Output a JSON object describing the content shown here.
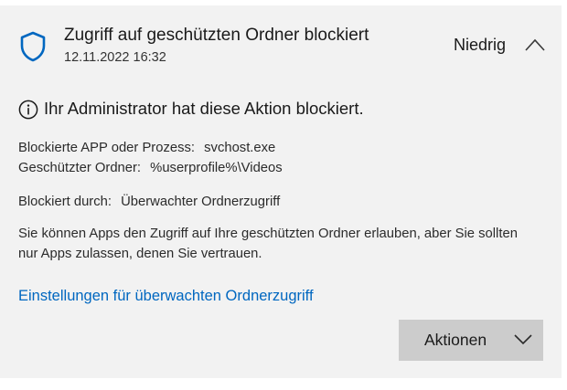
{
  "header": {
    "title": "Zugriff auf geschützten Ordner blockiert",
    "timestamp": "12.11.2022 16:32",
    "severity": "Niedrig",
    "icon": "shield-icon",
    "expand_icon": "chevron-up-icon"
  },
  "notice": {
    "icon": "info-icon",
    "text": "Ihr Administrator hat diese Aktion blockiert."
  },
  "details": {
    "app_label": "Blockierte APP oder Prozess:",
    "app_value": "svchost.exe",
    "folder_label": "Geschützter Ordner:",
    "folder_value": "%userprofile%\\Videos",
    "blocked_by_label": "Blockiert durch:",
    "blocked_by_value": "Überwachter Ordnerzugriff"
  },
  "description": "Sie können Apps den Zugriff auf Ihre geschützten Ordner erlauben, aber Sie sollten nur Apps zulassen, denen Sie vertrauen.",
  "settings_link": "Einstellungen für überwachten Ordnerzugriff",
  "actions_button": {
    "label": "Aktionen",
    "icon": "chevron-down-icon"
  },
  "colors": {
    "panel_bg": "#f2f2f2",
    "accent": "#0067c0",
    "button_bg": "#cccccc"
  }
}
